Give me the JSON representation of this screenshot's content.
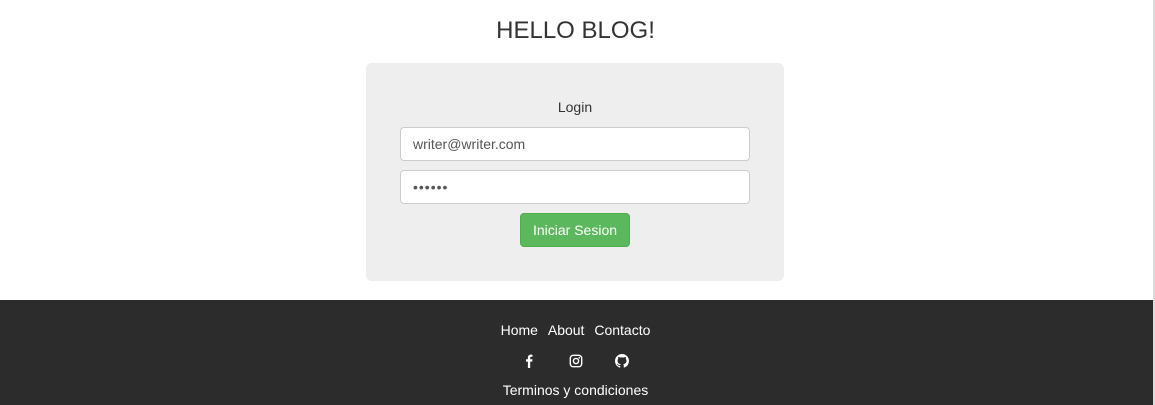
{
  "header": {
    "title": "HELLO BLOG!"
  },
  "login": {
    "heading": "Login",
    "email_value": "writer@writer.com",
    "password_value": "••••••",
    "submit_label": "Iniciar Sesion"
  },
  "footer": {
    "nav": [
      {
        "label": "Home"
      },
      {
        "label": "About"
      },
      {
        "label": "Contacto"
      }
    ],
    "social_icons": [
      "facebook-icon",
      "instagram-icon",
      "github-icon"
    ],
    "terms_label": "Terminos y condiciones"
  },
  "colors": {
    "card_bg": "#eeeeee",
    "button_green": "#5cb85c",
    "footer_bg": "#2c2c2c"
  }
}
